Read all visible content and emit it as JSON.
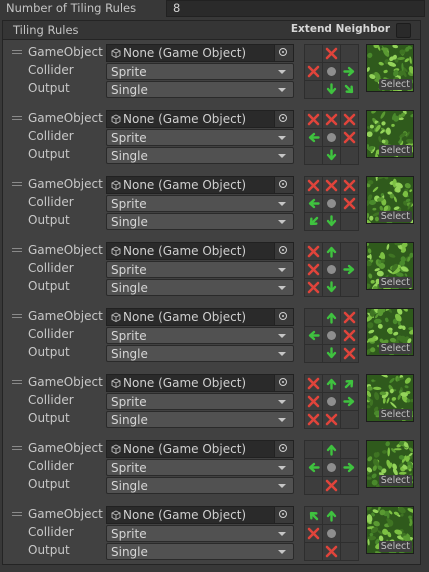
{
  "top": {
    "label": "Number of Tiling Rules",
    "value": "8"
  },
  "header": {
    "title": "Tiling Rules",
    "extend_label": "Extend Neighbor"
  },
  "labels": {
    "gameobject": "GameObject",
    "collider": "Collider",
    "output": "Output"
  },
  "rules": [
    {
      "gameobject": "None (Game Object)",
      "collider": "Sprite",
      "output": "Single",
      "select": "Select",
      "neighbors": [
        "none",
        "x",
        "none",
        "x",
        "center",
        "right",
        "none",
        "down",
        "down-right"
      ]
    },
    {
      "gameobject": "None (Game Object)",
      "collider": "Sprite",
      "output": "Single",
      "select": "Select",
      "neighbors": [
        "x",
        "x",
        "x",
        "left",
        "center",
        "x",
        "none",
        "down",
        "none"
      ]
    },
    {
      "gameobject": "None (Game Object)",
      "collider": "Sprite",
      "output": "Single",
      "select": "Select",
      "neighbors": [
        "x",
        "x",
        "x",
        "left",
        "center",
        "x",
        "down-left",
        "down",
        "none"
      ]
    },
    {
      "gameobject": "None (Game Object)",
      "collider": "Sprite",
      "output": "Single",
      "select": "Select",
      "neighbors": [
        "x",
        "up",
        "none",
        "x",
        "center",
        "right",
        "x",
        "down",
        "none"
      ]
    },
    {
      "gameobject": "None (Game Object)",
      "collider": "Sprite",
      "output": "Single",
      "select": "Select",
      "neighbors": [
        "none",
        "up",
        "x",
        "left",
        "center",
        "x",
        "none",
        "down",
        "x"
      ]
    },
    {
      "gameobject": "None (Game Object)",
      "collider": "Sprite",
      "output": "Single",
      "select": "Select",
      "neighbors": [
        "x",
        "up",
        "up-right",
        "x",
        "center",
        "right",
        "x",
        "x",
        "none"
      ]
    },
    {
      "gameobject": "None (Game Object)",
      "collider": "Sprite",
      "output": "Single",
      "select": "Select",
      "neighbors": [
        "none",
        "up",
        "none",
        "left",
        "center",
        "right",
        "none",
        "x",
        "none"
      ]
    },
    {
      "gameobject": "None (Game Object)",
      "collider": "Sprite",
      "output": "Single",
      "select": "Select",
      "neighbors": [
        "up-left",
        "up",
        "none",
        "x",
        "center",
        "none",
        "none",
        "x",
        "none"
      ]
    }
  ],
  "colors": {
    "x": "#e0443b",
    "arrow": "#3fc23f",
    "grass": "#4f8a2a"
  }
}
